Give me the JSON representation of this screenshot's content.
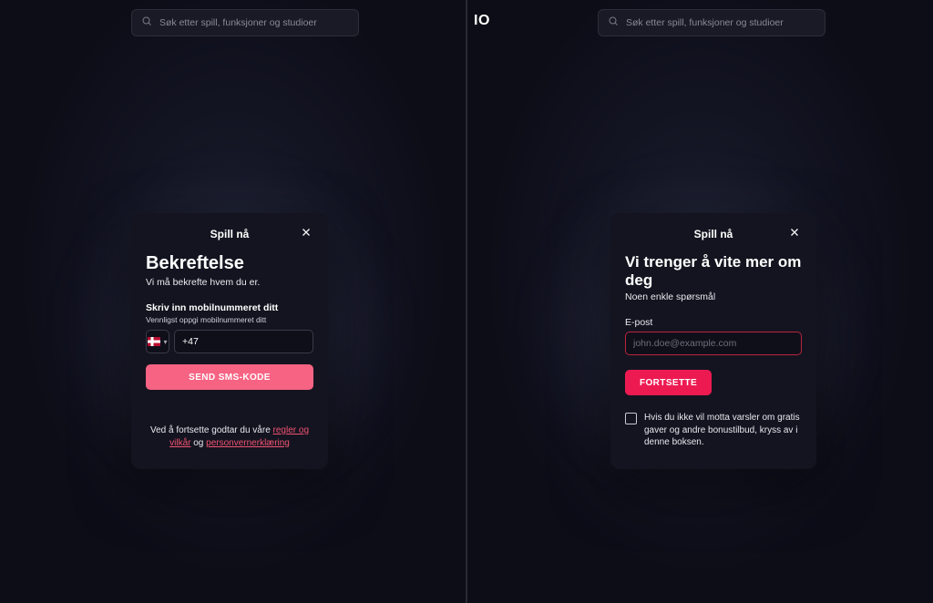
{
  "search": {
    "placeholder": "Søk etter spill, funksjoner og studioer"
  },
  "logo_fragment": "IO",
  "left_modal": {
    "header_title": "Spill nå",
    "heading": "Bekreftelse",
    "subtext": "Vi må bekrefte hvem du er.",
    "phone_label": "Skriv inn mobilnummeret ditt",
    "phone_hint": "Vennligst oppgi mobilnummeret ditt",
    "phone_placeholder": "+47",
    "phone_value": "+47",
    "send_button": "Send SMS-kode",
    "disclaimer_prefix": "Ved å fortsette godtar du våre ",
    "link_terms": "regler og vilkår",
    "disclaimer_mid": " og ",
    "link_privacy": "personvernerklæring"
  },
  "right_modal": {
    "header_title": "Spill nå",
    "heading": "Vi trenger å vite mer om deg",
    "subtext": "Noen enkle spørsmål",
    "email_label": "E-post",
    "email_placeholder": "john.doe@example.com",
    "continue_button": "Fortsette",
    "optout_text": "Hvis du ikke vil motta varsler om gratis gaver og andre bonustilbud, kryss av i denne boksen."
  },
  "colors": {
    "accent": "#ed1a52",
    "accent_light": "#f76383",
    "error_border": "#b8243c"
  }
}
